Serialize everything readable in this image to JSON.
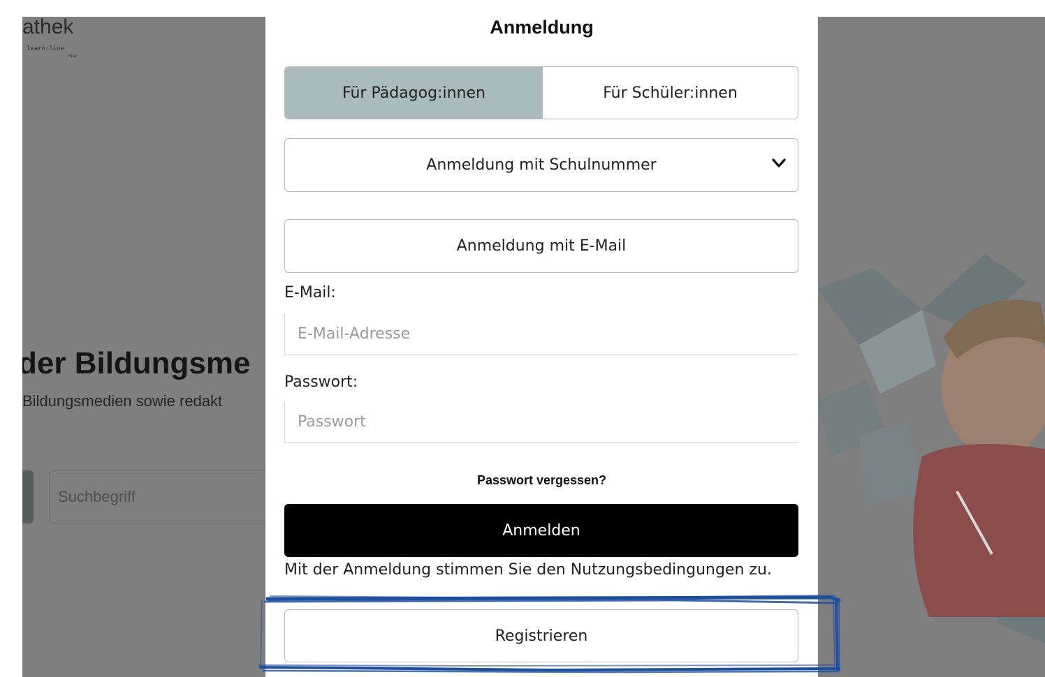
{
  "background": {
    "logo_text": "athek",
    "logo_sub": "learn:line",
    "logo_sub2": "NRW",
    "headline": "der Bildungsme",
    "subline": "Bildungsmedien sowie redakt",
    "search_placeholder": "Suchbegriff"
  },
  "modal": {
    "title": "Anmeldung",
    "tabs": [
      {
        "label": "Für Pädagog:innen",
        "active": true
      },
      {
        "label": "Für Schüler:innen",
        "active": false
      }
    ],
    "select_value": "Anmeldung mit Schulnummer",
    "email_method_label": "Anmeldung mit E-Mail",
    "email_label": "E-Mail:",
    "email_placeholder": "E-Mail-Adresse",
    "password_label": "Passwort:",
    "password_placeholder": "Passwort",
    "forgot_label": "Passwort vergessen?",
    "login_label": "Anmelden",
    "terms_text": "Mit der Anmeldung stimmen Sie den Nutzungsbedingungen zu.",
    "register_label": "Registrieren"
  },
  "colors": {
    "active_tab": "#a9bbbd",
    "login_button": "#000000",
    "highlight": "#1f4fa0",
    "overlay": "#7f7f7f"
  },
  "icons": {
    "select_chevron": "chevron-down-icon"
  }
}
